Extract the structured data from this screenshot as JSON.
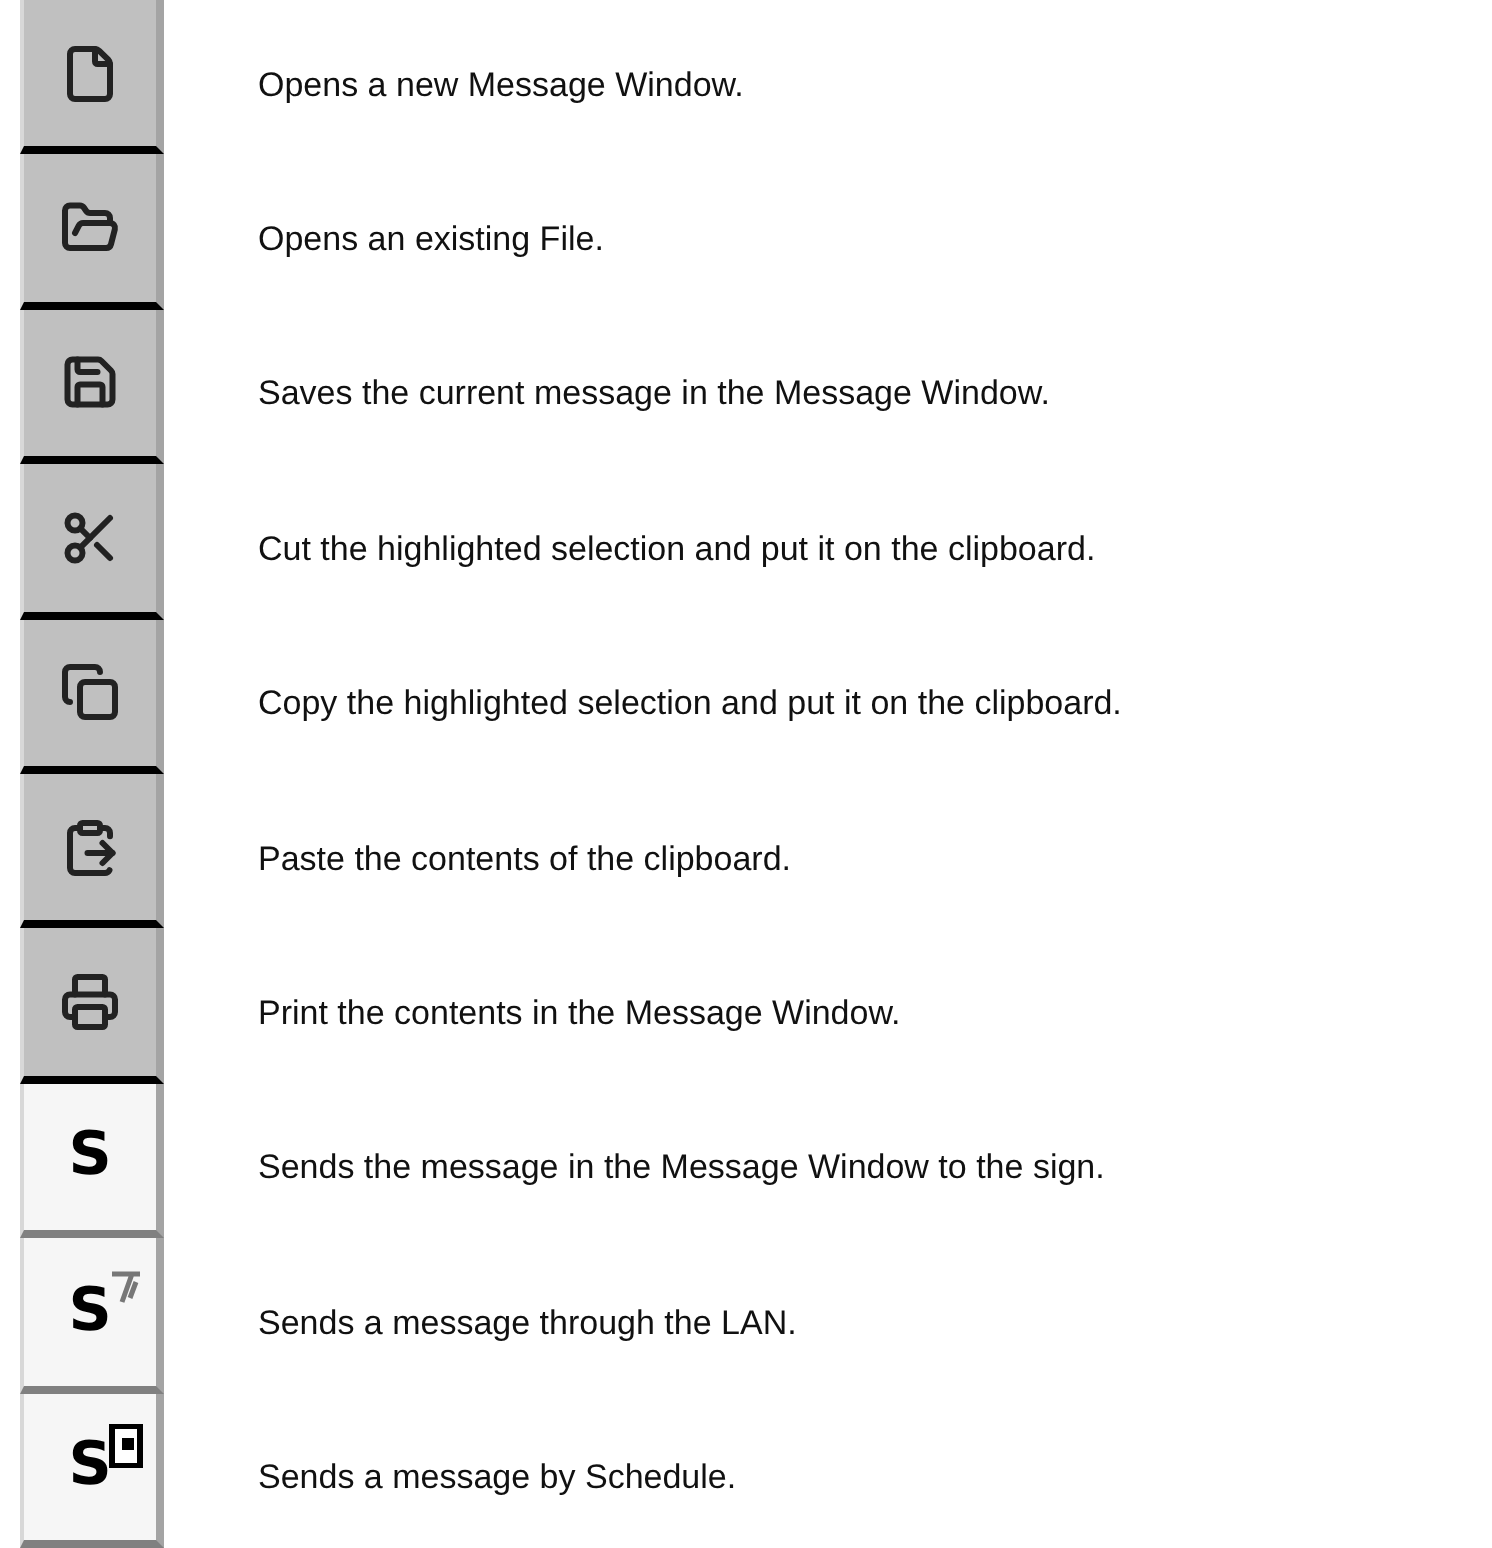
{
  "toolbar_legend": [
    {
      "kind": "new",
      "highlighted": false,
      "description": "Opens a new Message Window."
    },
    {
      "kind": "open",
      "highlighted": false,
      "description": "Opens an existing File."
    },
    {
      "kind": "save",
      "highlighted": false,
      "description": "Saves the current message in the Message Window."
    },
    {
      "kind": "cut",
      "highlighted": false,
      "description": "Cut the highlighted selection and put it on the clipboard."
    },
    {
      "kind": "copy",
      "highlighted": false,
      "description": "Copy the highlighted selection and put it on the clipboard."
    },
    {
      "kind": "paste",
      "highlighted": false,
      "description": "Paste the contents of the clipboard."
    },
    {
      "kind": "print",
      "highlighted": false,
      "description": "Print the contents in the Message Window."
    },
    {
      "kind": "send",
      "glyph": "S",
      "highlighted": true,
      "description": "Sends the message in the Message Window to the sign."
    },
    {
      "kind": "lan",
      "glyph": "S",
      "highlighted": true,
      "description": "Sends a message through the LAN."
    },
    {
      "kind": "schedule",
      "glyph": "S",
      "highlighted": true,
      "description": "Sends a message by Schedule."
    }
  ]
}
